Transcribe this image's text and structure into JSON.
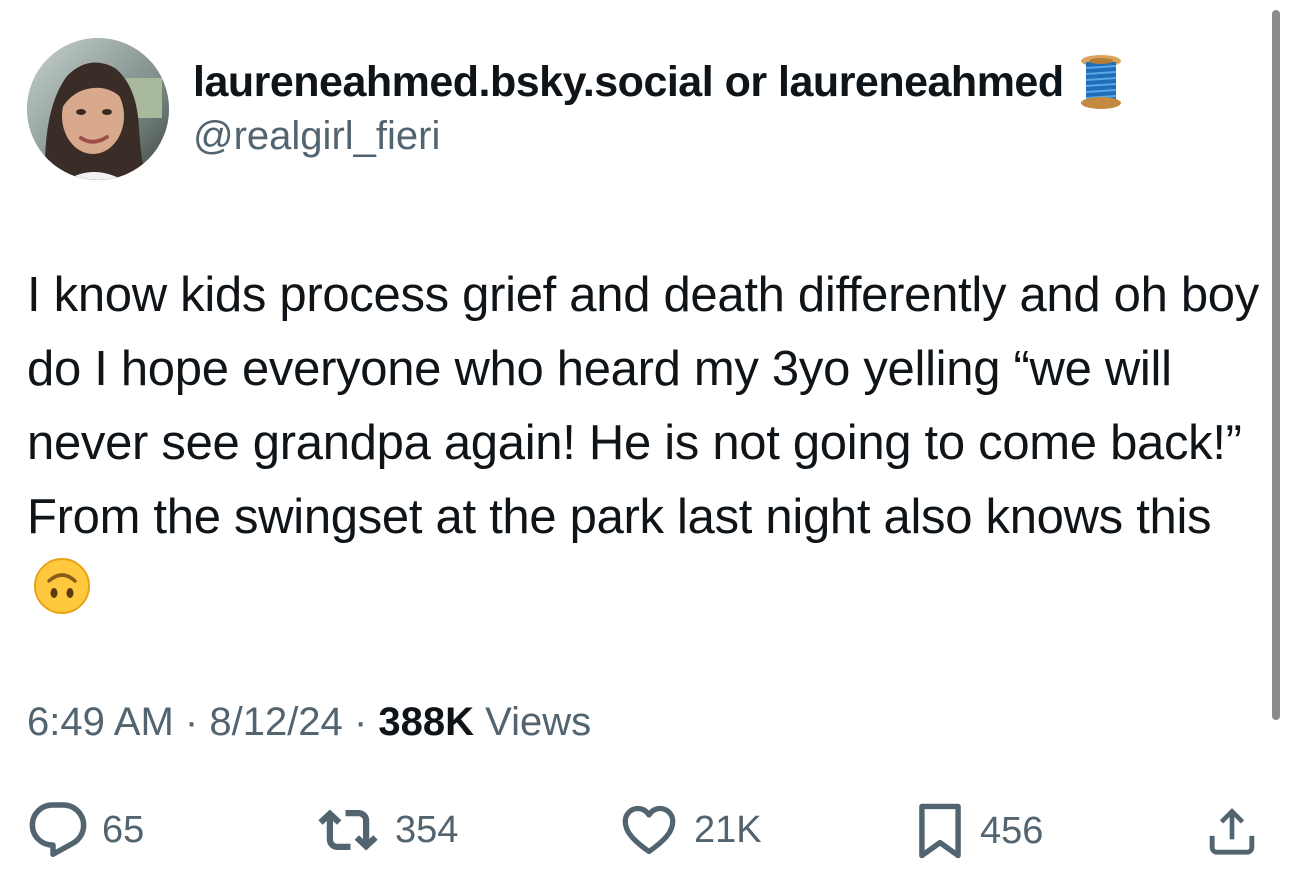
{
  "author": {
    "display_name": "laureneahmed.bsky.social or laureneahmed",
    "display_name_emoji": "spool-of-thread-icon",
    "handle": "@realgirl_fieri"
  },
  "tweet": {
    "text": "I know kids process grief and death differently and oh boy do I hope everyone who heard my 3yo yelling “we will never see grandpa again! He is not going to come back!” From the swingset at the park last night also knows this",
    "trailing_emoji": "upside-down-face-icon"
  },
  "meta": {
    "time": "6:49 AM",
    "separator": "·",
    "date": "8/12/24",
    "views_count": "388K",
    "views_label": "Views"
  },
  "actions": {
    "replies": "65",
    "retweets": "354",
    "likes": "21K",
    "bookmarks": "456"
  },
  "colors": {
    "text": "#0f1419",
    "secondary": "#536471",
    "background": "#ffffff"
  }
}
